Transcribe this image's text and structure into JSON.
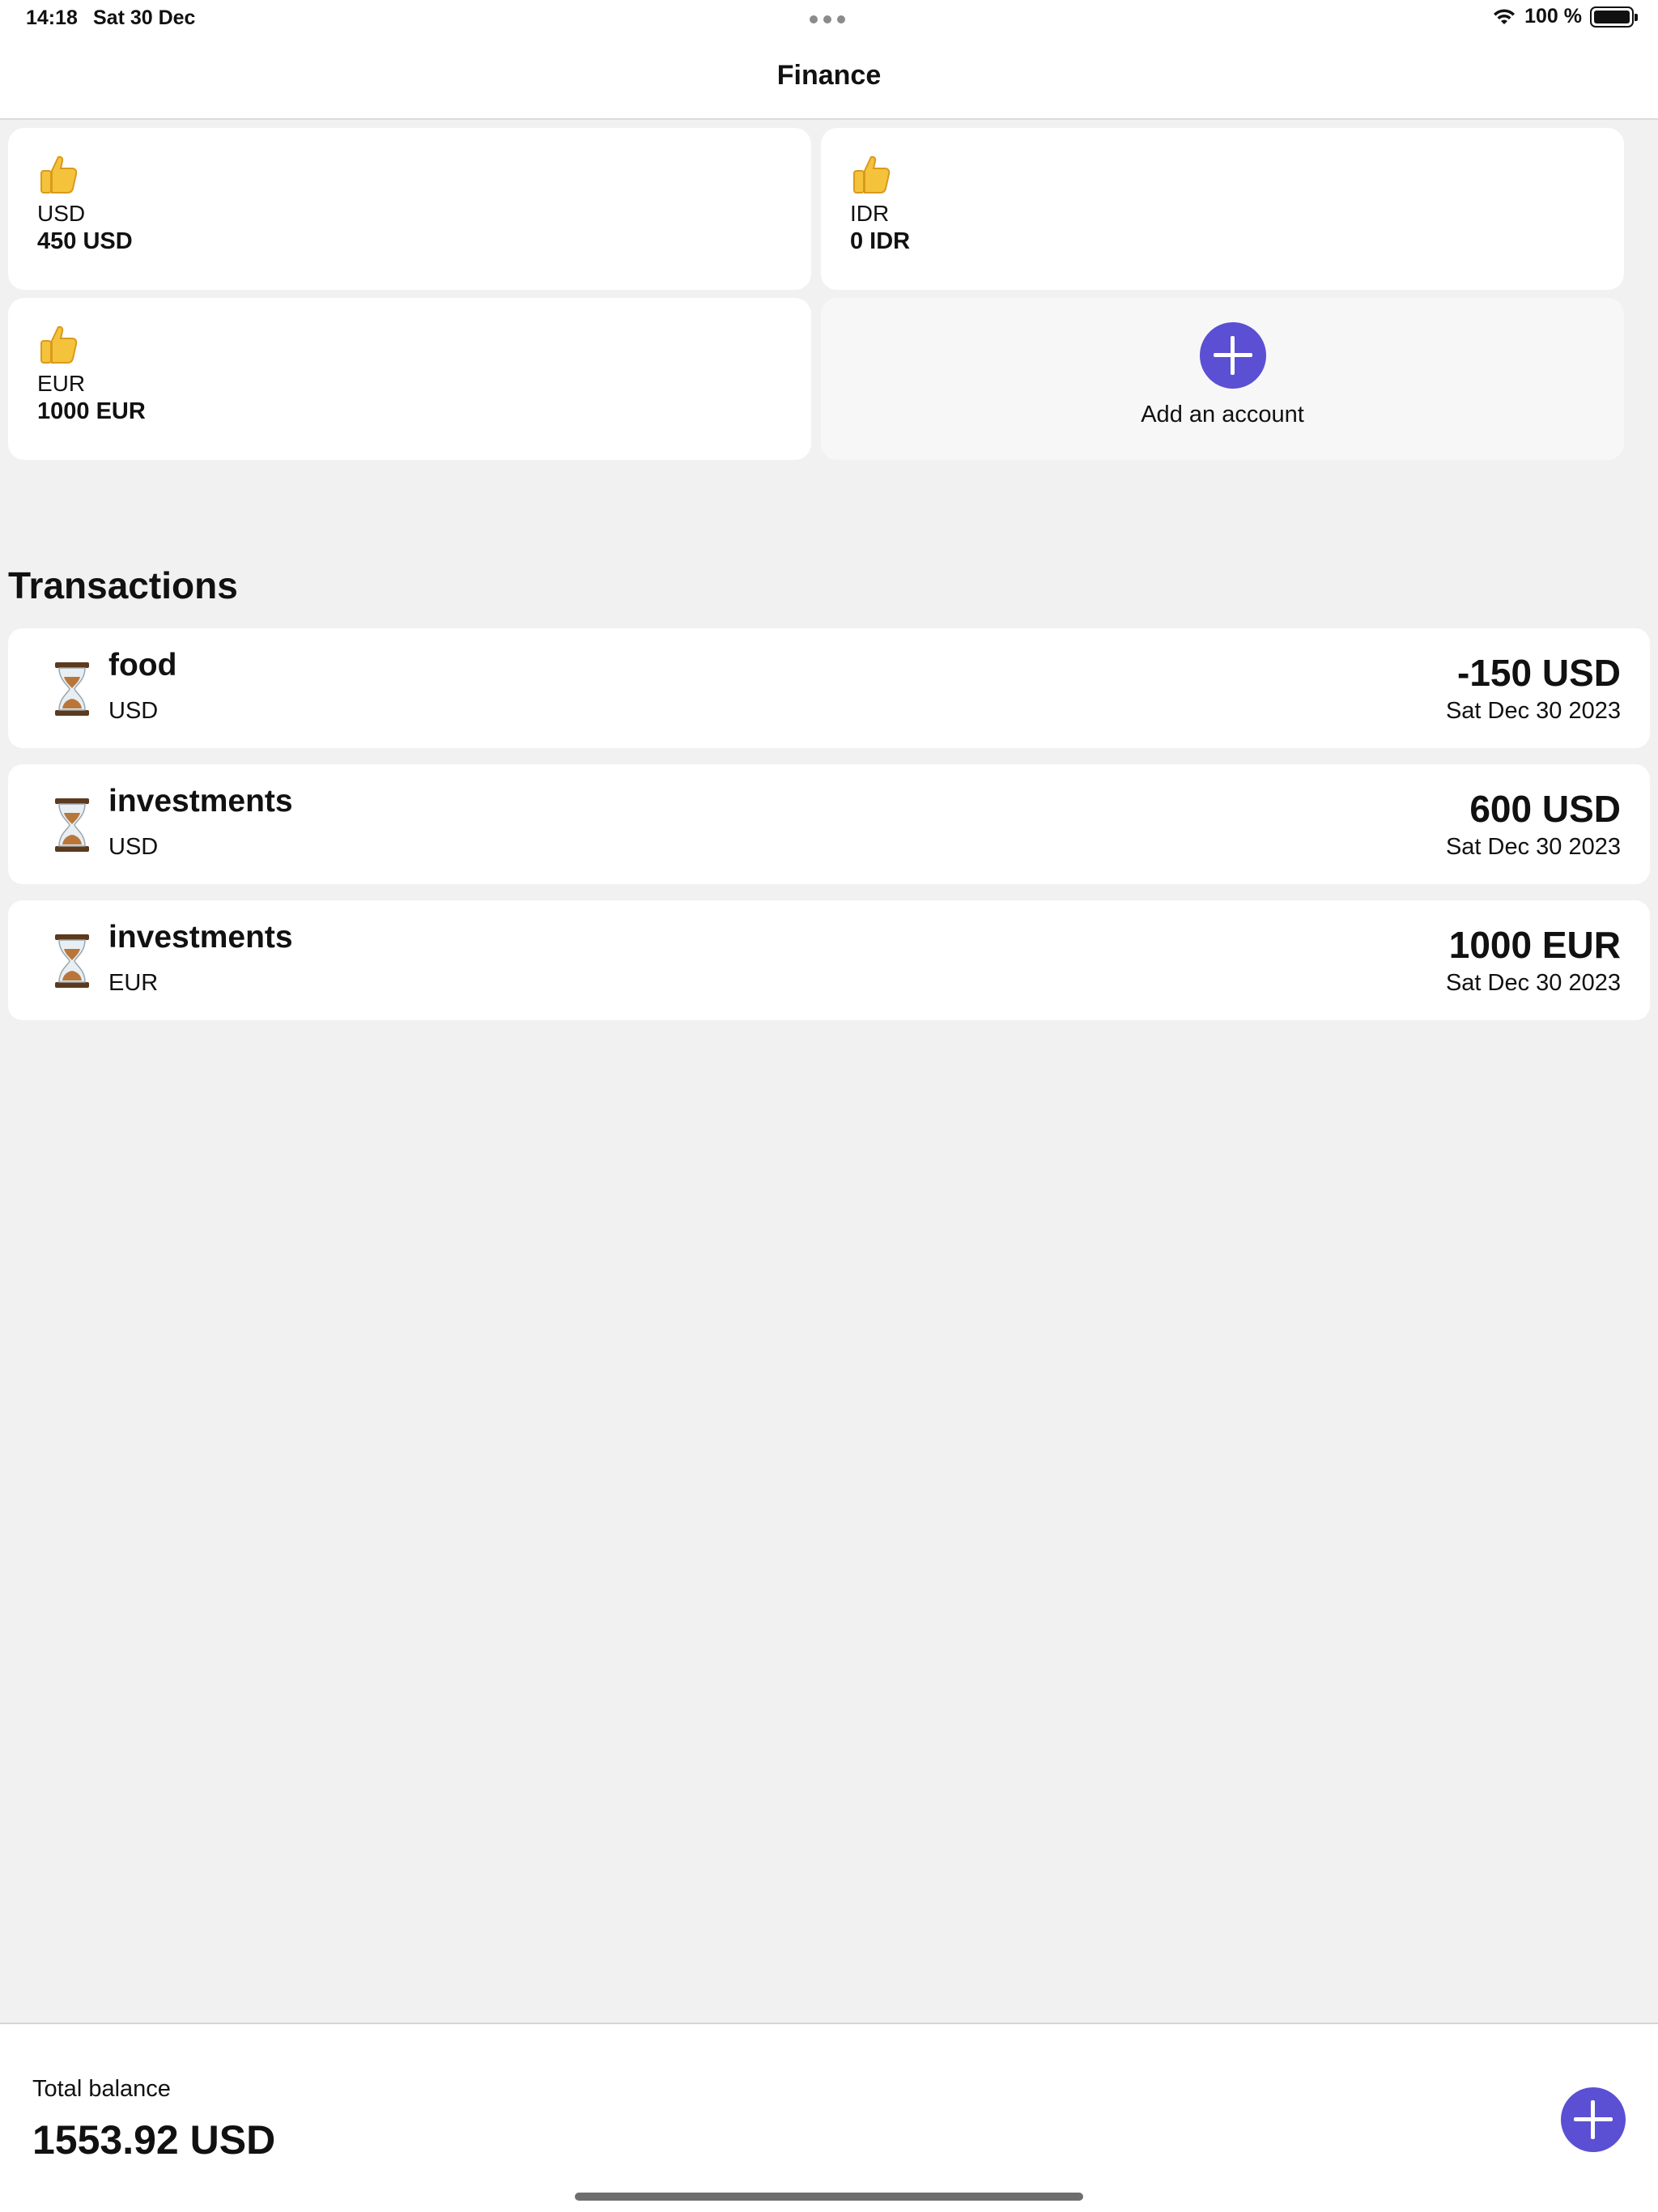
{
  "status_bar": {
    "time": "14:18",
    "date": "Sat 30 Dec",
    "battery_text": "100 %"
  },
  "nav": {
    "title": "Finance"
  },
  "accounts": [
    {
      "name": "USD",
      "amount": "450 USD",
      "icon": "thumbs-up-emoji"
    },
    {
      "name": "IDR",
      "amount": "0 IDR",
      "icon": "thumbs-up-emoji"
    },
    {
      "name": "EUR",
      "amount": "1000 EUR",
      "icon": "thumbs-up-emoji"
    }
  ],
  "add_account": {
    "label": "Add an account",
    "icon": "plus-icon"
  },
  "transactions_title": "Transactions",
  "transactions": [
    {
      "category": "food",
      "currency": "USD",
      "amount": "-150 USD",
      "date": "Sat Dec 30 2023",
      "icon": "hourglass-emoji"
    },
    {
      "category": "investments",
      "currency": "USD",
      "amount": "600 USD",
      "date": "Sat Dec 30 2023",
      "icon": "hourglass-emoji"
    },
    {
      "category": "investments",
      "currency": "EUR",
      "amount": "1000 EUR",
      "date": "Sat Dec 30 2023",
      "icon": "hourglass-emoji"
    }
  ],
  "footer": {
    "total_label": "Total balance",
    "total_value": "1553.92 USD"
  },
  "colors": {
    "accent": "#5b4fd3",
    "background": "#f1f1f1",
    "card": "#ffffff"
  }
}
